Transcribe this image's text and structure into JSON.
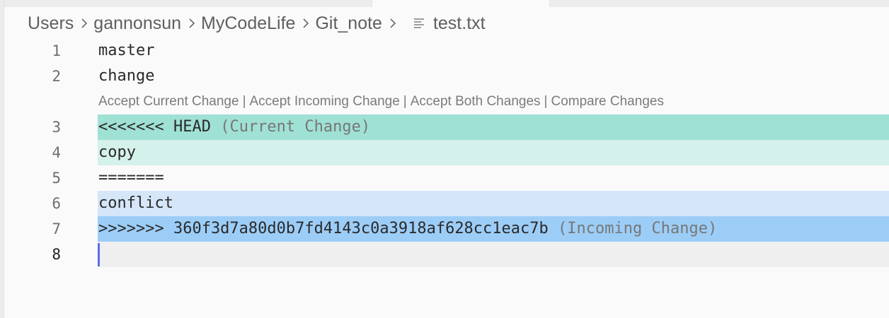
{
  "breadcrumb": {
    "items": [
      "Users",
      "gannonsun",
      "MyCodeLife",
      "Git_note"
    ],
    "file_icon": "text-file-icon",
    "file": "test.txt"
  },
  "codelens": {
    "actions": [
      "Accept Current Change",
      "Accept Incoming Change",
      "Accept Both Changes",
      "Compare Changes"
    ],
    "separator": "|"
  },
  "lines": [
    {
      "number": "1",
      "text": "master"
    },
    {
      "number": "2",
      "text": "change"
    },
    {
      "number": "3",
      "text": "<<<<<<< HEAD",
      "hint": "(Current Change)"
    },
    {
      "number": "4",
      "text": "copy"
    },
    {
      "number": "5",
      "text": "======="
    },
    {
      "number": "6",
      "text": "conflict"
    },
    {
      "number": "7",
      "text": ">>>>>>> 360f3d7a80d0b7fd4143c0a3918af628cc1eac7b",
      "hint": "(Incoming Change)"
    },
    {
      "number": "8",
      "text": ""
    }
  ],
  "colors": {
    "current_header": "#9fe1d4",
    "current_body": "#d5f1eb",
    "incoming_body": "#d4e6f8",
    "incoming_header": "#9ccdf7",
    "caret": "#5b6ee8"
  }
}
